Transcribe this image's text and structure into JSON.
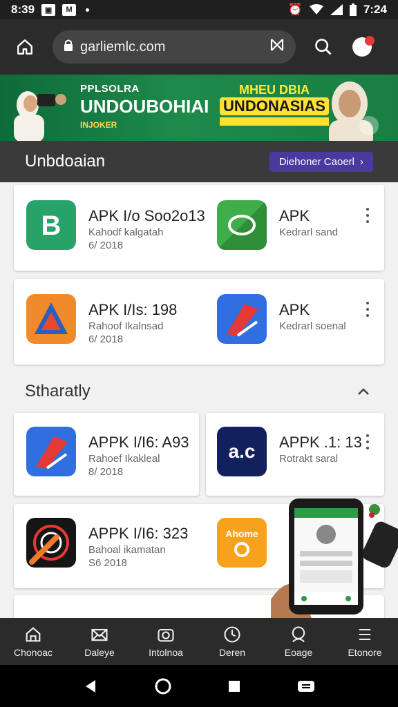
{
  "status_bar": {
    "time": "8:39",
    "right_time": "7:24"
  },
  "browser": {
    "url": "garliemlc.com"
  },
  "banner": {
    "kicker": "PPLSOLRA",
    "headline": "UNDOUBOHIAI",
    "sub": "INJOKER",
    "right_line1": "MHEU DBIA",
    "right_line2": "UNDONASIAS"
  },
  "section": {
    "title": "Unbdoaian",
    "button_label": "Diehoner Caoerl"
  },
  "apps_top": [
    {
      "title": "APK I/o Soo2o13",
      "sub": "Kahodf kalgatah",
      "date": "6/ 2018"
    },
    {
      "title": "APK",
      "sub": "Kedrarl sand",
      "date": ""
    },
    {
      "title": "APK I/Is: 198",
      "sub": "Rahoof Ikalnsad",
      "date": "6/ 2018"
    },
    {
      "title": "APK",
      "sub": "Kedrarl soenal",
      "date": ""
    }
  ],
  "subsection": {
    "title": "Stharatly"
  },
  "apps_bottom": [
    {
      "title": "APPK I/I6: A93",
      "sub": "Rahoef Ikakleal",
      "date": "8/ 2018"
    },
    {
      "title": "APPK .1: 13",
      "sub": "Rotrakt saral",
      "date": "",
      "icon_text": "a.c"
    },
    {
      "title": "APPK I/I6: 323",
      "sub": "Bahoal ikamatan",
      "date": "S6 2018"
    },
    {
      "title": "",
      "sub": "",
      "date": "",
      "icon_text": "Ahome"
    }
  ],
  "bottom_nav": [
    {
      "label": "Chonoac",
      "icon": "home-icon"
    },
    {
      "label": "Daleye",
      "icon": "mail-icon"
    },
    {
      "label": "Intolnoa",
      "icon": "camera-icon"
    },
    {
      "label": "Deren",
      "icon": "compass-icon"
    },
    {
      "label": "Eoage",
      "icon": "profile-icon"
    },
    {
      "label": "Etonore",
      "icon": "menu-icon"
    }
  ],
  "colors": {
    "accent_green": "#1d8a4a",
    "section_button": "#4a3aa0"
  }
}
